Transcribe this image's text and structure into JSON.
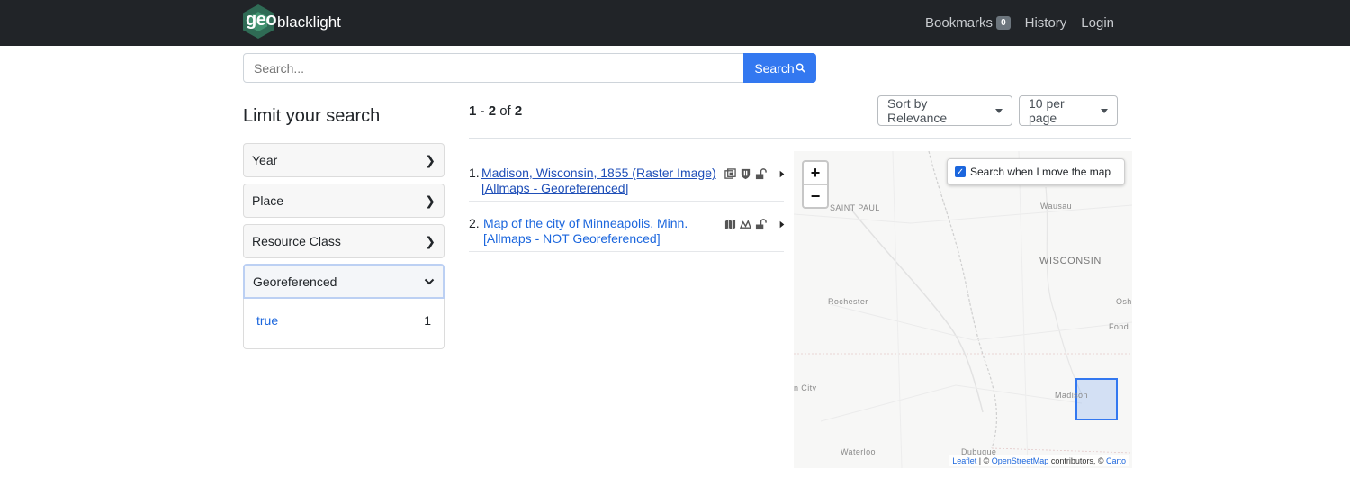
{
  "navbar": {
    "brand_geo": "geo",
    "brand_name": "blacklight",
    "bookmarks_label": "Bookmarks",
    "bookmarks_count": "0",
    "history_label": "History",
    "login_label": "Login"
  },
  "search": {
    "placeholder": "Search...",
    "button_label": "Search"
  },
  "sidebar": {
    "title": "Limit your search",
    "facets": [
      {
        "label": "Year"
      },
      {
        "label": "Place"
      },
      {
        "label": "Resource Class"
      },
      {
        "label": "Georeferenced"
      }
    ],
    "open_facet_values": [
      {
        "label": "true",
        "count": "1"
      }
    ]
  },
  "results_header": {
    "start": "1",
    "dash": " - ",
    "end": "2",
    "of": " of ",
    "total": "2",
    "sort_label": "Sort by Relevance",
    "per_page_label": "10 per page"
  },
  "results": [
    {
      "num": "1.",
      "title": "Madison, Wisconsin, 1855 (Raster Image) [Allmaps - Georeferenced]"
    },
    {
      "num": "2.",
      "title": "Map of the city of Minneapolis, Minn. [Allmaps - NOT Georeferenced]"
    }
  ],
  "map": {
    "zoom_in": "+",
    "zoom_out": "−",
    "search_when_move": "Search when I move the map",
    "labels": {
      "saint_paul": "SAINT PAUL",
      "wausau": "Wausau",
      "wisconsin": "WISCONSIN",
      "rochester": "Rochester",
      "osh": "Osh",
      "fond": "Fond",
      "city": "n City",
      "madison": "Madison",
      "waterloo": "Waterloo",
      "dubuque": "Dubuque"
    },
    "attribution": {
      "leaflet": "Leaflet",
      "sep1": " | © ",
      "osm": "OpenStreetMap",
      "mid": " contributors, © ",
      "carto": "Carto"
    }
  },
  "colors": {
    "navbar_bg": "#212428",
    "accent": "#3378f0",
    "link": "#1b66dd"
  }
}
